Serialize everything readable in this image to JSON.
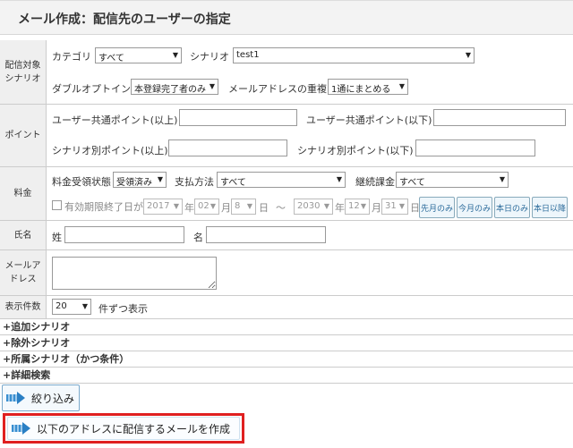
{
  "page": {
    "title": "メール作成：配信先のユーザーの指定"
  },
  "rows": {
    "target": {
      "label": "配信対象シナリオ",
      "category_label": "カテゴリ",
      "category_value": "すべて",
      "scenario_label": "シナリオ",
      "scenario_value": "test1",
      "double_optin_label": "ダブルオプトイン",
      "double_optin_value": "本登録完了者のみ",
      "duplicate_label": "メールアドレスの重複",
      "duplicate_value": "1通にまとめる"
    },
    "points": {
      "label": "ポイント",
      "common_min_label": "ユーザー共通ポイント(以上)",
      "common_max_label": "ユーザー共通ポイント(以下)",
      "scenario_min_label": "シナリオ別ポイント(以上)",
      "scenario_max_label": "シナリオ別ポイント(以下)"
    },
    "fee": {
      "label": "料金",
      "status_label": "料金受領状態",
      "status_value": "受領済み",
      "payment_label": "支払方法",
      "payment_value": "すべて",
      "recurring_label": "継続課金",
      "recurring_value": "すべて",
      "expiry_label": "有効期限終了日が",
      "from_year": "2017",
      "from_month": "02",
      "from_day": "8",
      "to_year": "2030",
      "to_month": "12",
      "to_day": "31",
      "year_unit": "年",
      "month_unit": "月",
      "day_unit": "日",
      "range_sep": "～",
      "btn_last_month": "先月のみ",
      "btn_this_month": "今月のみ",
      "btn_today": "本日のみ",
      "btn_after_today": "本日以降"
    },
    "name": {
      "label": "氏名",
      "last_label": "姓",
      "first_label": "名"
    },
    "email": {
      "label": "メールアドレス"
    },
    "count": {
      "label": "表示件数",
      "value": "20",
      "suffix": "件ずつ表示"
    }
  },
  "expanders": [
    "+追加シナリオ",
    "+除外シナリオ",
    "+所属シナリオ（かつ条件）",
    "+詳細検索"
  ],
  "buttons": {
    "filter": "絞り込み",
    "create_mail": "以下のアドレスに配信するメールを作成"
  },
  "icons": {
    "dropdown": "▼"
  },
  "colors": {
    "highlight": "#e02020",
    "accent": "#3a8fd0"
  }
}
